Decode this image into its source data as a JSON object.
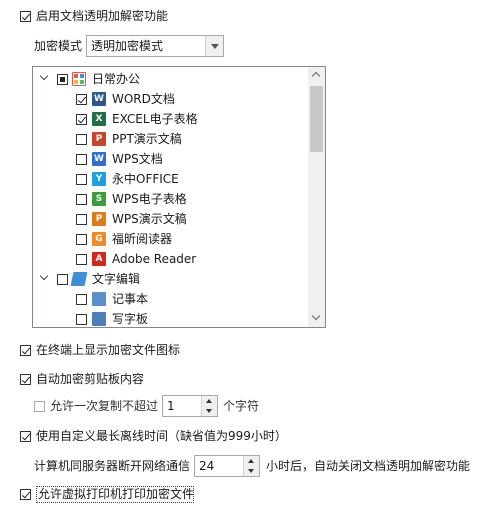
{
  "options": {
    "enable_transparent": {
      "label": "启用文档透明加解密功能",
      "checked": true
    },
    "mode_label": "加密模式",
    "mode_value": "透明加密模式",
    "show_icon": {
      "label": "在终端上显示加密文件图标",
      "checked": true
    },
    "clipboard": {
      "label": "自动加密剪贴板内容",
      "checked": true
    },
    "allow_copy": {
      "label_pre": "允许一次复制不超过",
      "value": "1",
      "label_post": "个字符",
      "checked": false
    },
    "offline": {
      "label": "使用自定义最长离线时间（缺省值为999小时）",
      "checked": true
    },
    "offline_detail": {
      "label_pre": "计算机同服务器断开网络通信",
      "value": "24",
      "label_post": "小时后，自动关闭文档透明加解密功能"
    },
    "virtual_print": {
      "label": "允许虚拟打印机打印加密文件",
      "checked": true
    }
  },
  "tree": {
    "groups": [
      {
        "label": "日常办公",
        "state": "partial",
        "items": [
          {
            "label": "WORD文档",
            "checked": true,
            "icon": "word-icon",
            "color": "#2b5797",
            "glyph": "W"
          },
          {
            "label": "EXCEL电子表格",
            "checked": true,
            "icon": "excel-icon",
            "color": "#1e7145",
            "glyph": "X"
          },
          {
            "label": "PPT演示文稿",
            "checked": false,
            "icon": "powerpoint-icon",
            "color": "#c9462c",
            "glyph": "P"
          },
          {
            "label": "WPS文档",
            "checked": false,
            "icon": "wps-writer-icon",
            "color": "#2d6fd2",
            "glyph": "W"
          },
          {
            "label": "永中OFFICE",
            "checked": false,
            "icon": "yozo-office-icon",
            "color": "#1ba1e2",
            "glyph": "Y"
          },
          {
            "label": "WPS电子表格",
            "checked": false,
            "icon": "wps-sheet-icon",
            "color": "#3a9d3a",
            "glyph": "S"
          },
          {
            "label": "WPS演示文稿",
            "checked": false,
            "icon": "wps-presentation-icon",
            "color": "#e07b17",
            "glyph": "P"
          },
          {
            "label": "福昕阅读器",
            "checked": false,
            "icon": "foxit-reader-icon",
            "color": "#f08a24",
            "glyph": "G"
          },
          {
            "label": "Adobe Reader",
            "checked": false,
            "icon": "adobe-reader-icon",
            "color": "#d9261c",
            "glyph": "A"
          }
        ]
      },
      {
        "label": "文字编辑",
        "state": "unchecked",
        "items": [
          {
            "label": "记事本",
            "checked": false,
            "icon": "notepad-icon",
            "color": "#5a8fc9",
            "glyph": ""
          },
          {
            "label": "写字板",
            "checked": false,
            "icon": "wordpad-icon",
            "color": "#4a7fb8",
            "glyph": ""
          }
        ]
      }
    ]
  }
}
